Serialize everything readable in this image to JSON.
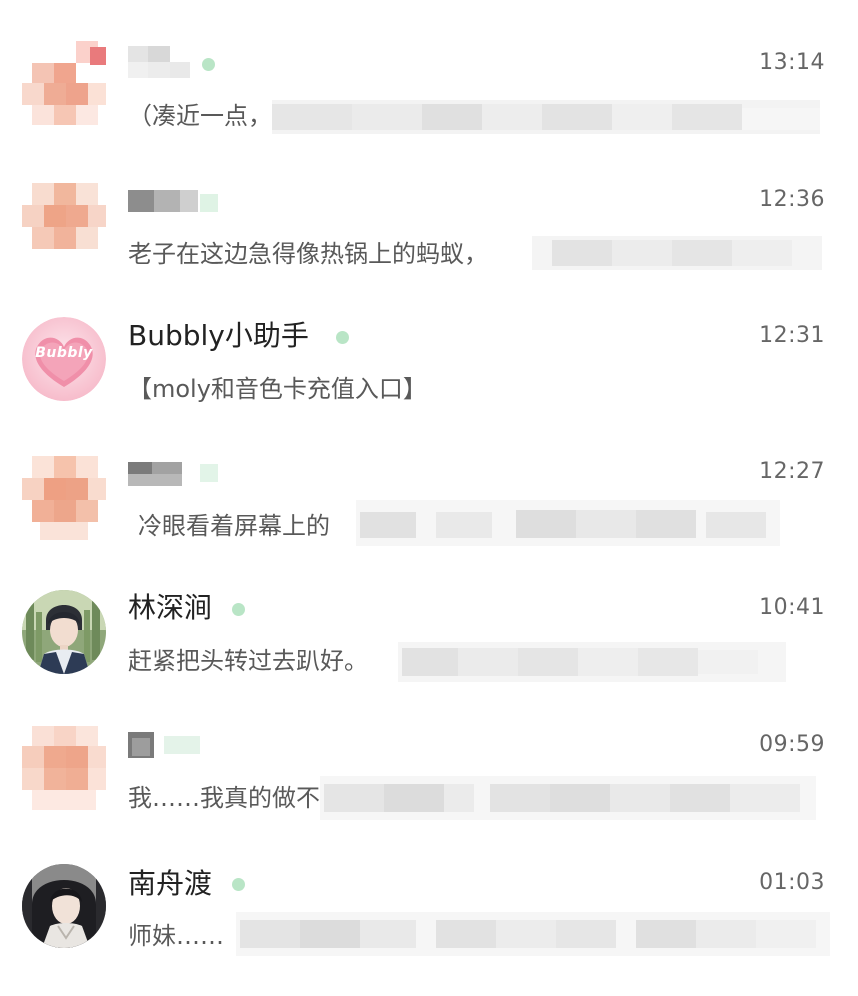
{
  "chats": [
    {
      "name": "",
      "time": "13:14",
      "preview": "（凑近一点，",
      "online": true
    },
    {
      "name": "",
      "time": "12:36",
      "preview": "老子在这边急得像热锅上的蚂蚁，",
      "online": true
    },
    {
      "name": "Bubbly小助手",
      "time": "12:31",
      "preview": "【moly和音色卡充值入口】",
      "online": true,
      "avatar_text": "Bubbly"
    },
    {
      "name": "",
      "time": "12:27",
      "preview": "冷眼看着屏幕上的",
      "online": true
    },
    {
      "name": "林深涧",
      "time": "10:41",
      "preview": "赶紧把头转过去趴好。",
      "online": true
    },
    {
      "name": "",
      "time": "09:59",
      "preview": "我……我真的做不",
      "online": true
    },
    {
      "name": "南舟渡",
      "time": "01:03",
      "preview": "师妹……",
      "online": true
    }
  ],
  "colors": {
    "online_dot": "#b9e5c6",
    "name_text": "#222222",
    "time_text": "#666666",
    "preview_text": "#595959"
  },
  "icons": {
    "online": "online-status-dot-icon"
  }
}
